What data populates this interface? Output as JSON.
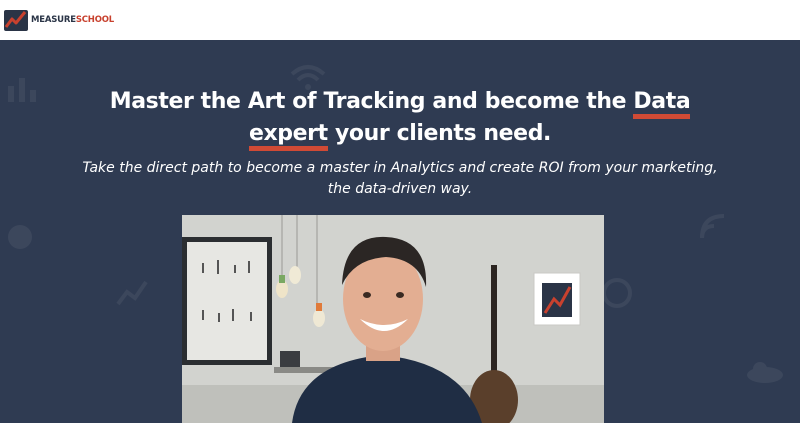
{
  "brand": {
    "name_part1": "MEASURE",
    "name_part2": "SCHOOL",
    "primary_color": "#2a3446",
    "accent_color": "#c8412e"
  },
  "hero": {
    "background_color": "#2f3b52",
    "headline_part1": "Master the Art of Tracking and become the ",
    "headline_highlight1": "Data",
    "headline_highlight2": "expert",
    "headline_part2": " your clients need.",
    "subtitle_line1": "Take the direct path to become a master in Analytics and create ROI from your marketing,",
    "subtitle_line2": "the data-driven way."
  },
  "video": {
    "subject": "presenter-speaking-in-room"
  }
}
